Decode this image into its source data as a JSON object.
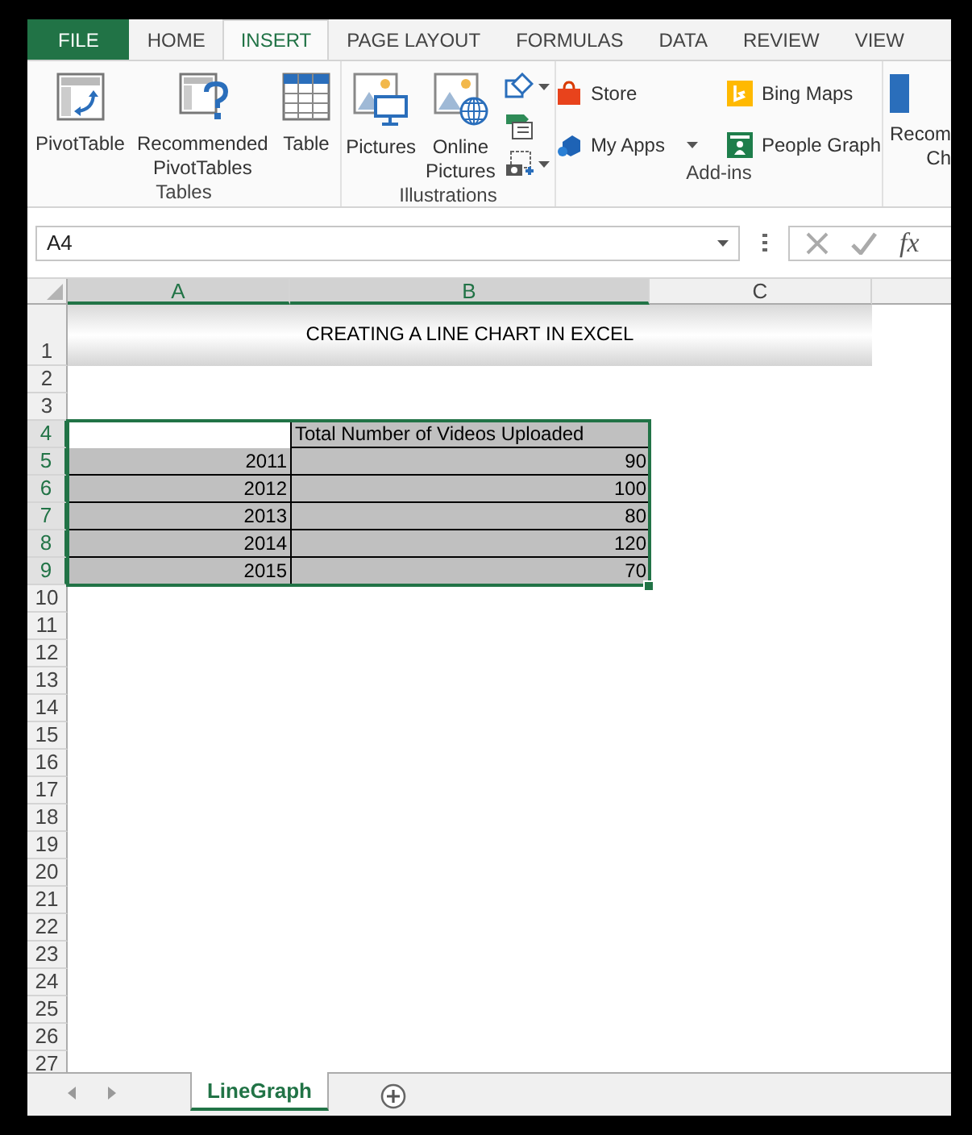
{
  "ribbon_tabs": [
    {
      "label": "FILE",
      "kind": "file",
      "selected": false
    },
    {
      "label": "HOME",
      "kind": "tab",
      "selected": false
    },
    {
      "label": "INSERT",
      "kind": "tab",
      "selected": true
    },
    {
      "label": "PAGE LAYOUT",
      "kind": "tab",
      "selected": false
    },
    {
      "label": "FORMULAS",
      "kind": "tab",
      "selected": false
    },
    {
      "label": "DATA",
      "kind": "tab",
      "selected": false
    },
    {
      "label": "REVIEW",
      "kind": "tab",
      "selected": false
    },
    {
      "label": "VIEW",
      "kind": "tab",
      "selected": false
    }
  ],
  "ribbon_groups": [
    {
      "label": "Tables",
      "kind": "large",
      "items": [
        {
          "kind": "pivottable",
          "label": "PivotTable"
        },
        {
          "kind": "recommended-pivot",
          "label": "Recommended PivotTables"
        },
        {
          "kind": "table",
          "label": "Table"
        }
      ]
    },
    {
      "label": "Illustrations",
      "kind": "large",
      "items": [
        {
          "kind": "pictures",
          "label": "Pictures"
        },
        {
          "kind": "online-pictures",
          "label": "Online Pictures"
        },
        {
          "kind": "small-stack",
          "items": [
            {
              "kind": "shapes",
              "has_menu": true
            },
            {
              "kind": "smartart",
              "has_menu": false
            },
            {
              "kind": "screenshot",
              "has_menu": true
            }
          ]
        }
      ]
    },
    {
      "label": "Add-ins",
      "kind": "grid",
      "items": [
        {
          "kind": "store",
          "label": "Store",
          "has_menu": false
        },
        {
          "kind": "bing-maps",
          "label": "Bing Maps",
          "has_menu": false
        },
        {
          "kind": "my-apps",
          "label": "My Apps",
          "has_menu": true
        },
        {
          "kind": "people-graph",
          "label": "People Graph",
          "has_menu": false
        }
      ]
    },
    {
      "kind": "partial",
      "items": [
        {
          "kind": "recommended-charts",
          "lines": [
            "Recom",
            "Ch"
          ]
        }
      ]
    }
  ],
  "formula_bar": {
    "name_box": "A4",
    "fx": "fx"
  },
  "columns": [
    {
      "label": "A",
      "selected": true
    },
    {
      "label": "B",
      "selected": true
    },
    {
      "label": "C",
      "selected": false
    }
  ],
  "rows": [
    {
      "header": "1",
      "kind": "title",
      "selected": false,
      "text": "CREATING A LINE CHART IN EXCEL"
    },
    {
      "header": "2",
      "kind": "blank",
      "selected": false
    },
    {
      "header": "3",
      "kind": "blank",
      "selected": false
    },
    {
      "header": "4",
      "kind": "table-header",
      "selected": true,
      "column_b": "Total Number of Videos Uploaded"
    },
    {
      "header": "5",
      "kind": "data",
      "selected": true,
      "column_a": "2011",
      "column_b": "90"
    },
    {
      "header": "6",
      "kind": "data",
      "selected": true,
      "column_a": "2012",
      "column_b": "100"
    },
    {
      "header": "7",
      "kind": "data",
      "selected": true,
      "column_a": "2013",
      "column_b": "80"
    },
    {
      "header": "8",
      "kind": "data",
      "selected": true,
      "column_a": "2014",
      "column_b": "120"
    },
    {
      "header": "9",
      "kind": "data",
      "selected": true,
      "column_a": "2015",
      "column_b": "70"
    },
    {
      "header": "10",
      "kind": "blank",
      "selected": false
    },
    {
      "header": "11",
      "kind": "blank",
      "selected": false
    },
    {
      "header": "12",
      "kind": "blank",
      "selected": false
    },
    {
      "header": "13",
      "kind": "blank",
      "selected": false
    },
    {
      "header": "14",
      "kind": "blank",
      "selected": false
    },
    {
      "header": "15",
      "kind": "blank",
      "selected": false
    },
    {
      "header": "16",
      "kind": "blank",
      "selected": false
    },
    {
      "header": "17",
      "kind": "blank",
      "selected": false
    },
    {
      "header": "18",
      "kind": "blank",
      "selected": false
    },
    {
      "header": "19",
      "kind": "blank",
      "selected": false
    },
    {
      "header": "20",
      "kind": "blank",
      "selected": false
    },
    {
      "header": "21",
      "kind": "blank",
      "selected": false
    },
    {
      "header": "22",
      "kind": "blank",
      "selected": false
    },
    {
      "header": "23",
      "kind": "blank",
      "selected": false
    },
    {
      "header": "24",
      "kind": "blank",
      "selected": false
    },
    {
      "header": "25",
      "kind": "blank",
      "selected": false
    },
    {
      "header": "26",
      "kind": "blank",
      "selected": false
    },
    {
      "header": "27",
      "kind": "blank",
      "selected": false
    }
  ],
  "sheet_tabs": [
    {
      "label": "LineGraph",
      "selected": true
    }
  ]
}
